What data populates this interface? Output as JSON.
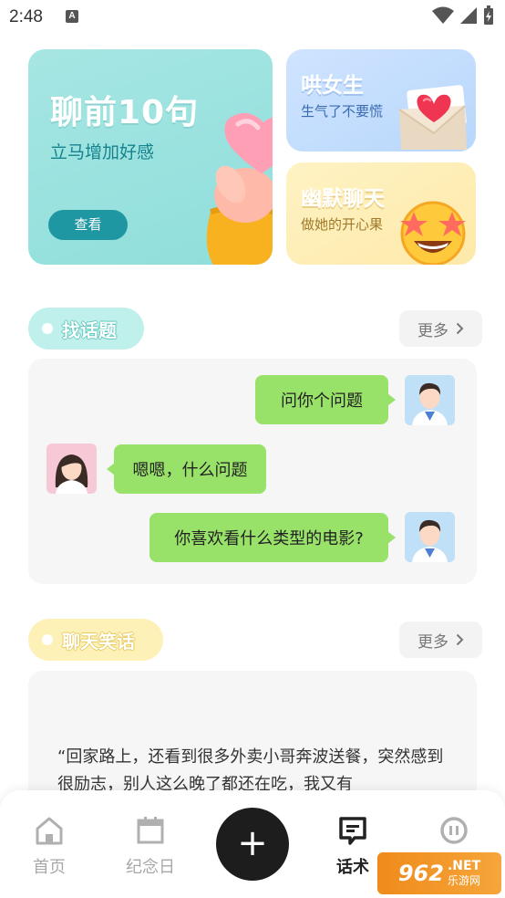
{
  "status_bar": {
    "time": "2:48",
    "notification_icon": "A",
    "icons": [
      "wifi-icon",
      "signal-icon",
      "battery-charging-icon"
    ]
  },
  "banners": {
    "main": {
      "title": "聊前10句",
      "subtitle": "立马增加好感",
      "button": "查看"
    },
    "coax": {
      "title": "哄女生",
      "subtitle": "生气了不要慌"
    },
    "humor": {
      "title": "幽默聊天",
      "subtitle": "做她的开心果"
    }
  },
  "topics_section": {
    "title": "找话题",
    "more": "更多",
    "messages": [
      {
        "side": "right",
        "text": "问你个问题",
        "avatar": "boy-avatar"
      },
      {
        "side": "left",
        "text": "嗯嗯，什么问题",
        "avatar": "girl-avatar"
      },
      {
        "side": "right",
        "text": "你喜欢看什么类型的电影?",
        "avatar": "boy-avatar"
      }
    ]
  },
  "jokes_section": {
    "title": "聊天笑话",
    "more": "更多",
    "joke_text": "“回家路上，还看到很多外卖小哥奔波送餐，突然感到很励志，别人这么晚了都还在吃，我又有"
  },
  "bottom_nav": {
    "items": [
      {
        "label": "首页",
        "icon": "home-icon",
        "active": false
      },
      {
        "label": "纪念日",
        "icon": "calendar-icon",
        "active": false
      },
      {
        "label": "话术",
        "icon": "chat-script-icon",
        "active": true
      },
      {
        "label": "",
        "icon": "profile-icon",
        "active": false
      }
    ],
    "add_symbol": "+"
  },
  "watermark": {
    "brand": "962",
    "suffix": ".NET",
    "sub": "乐游网"
  },
  "colors": {
    "teal_card": "#a6e6e3",
    "blue_card": "#cfe4ff",
    "yellow_card": "#fff3c4",
    "bubble_green": "#99e26a",
    "nav_active": "#222222",
    "nav_inactive": "#a8a8a8"
  }
}
